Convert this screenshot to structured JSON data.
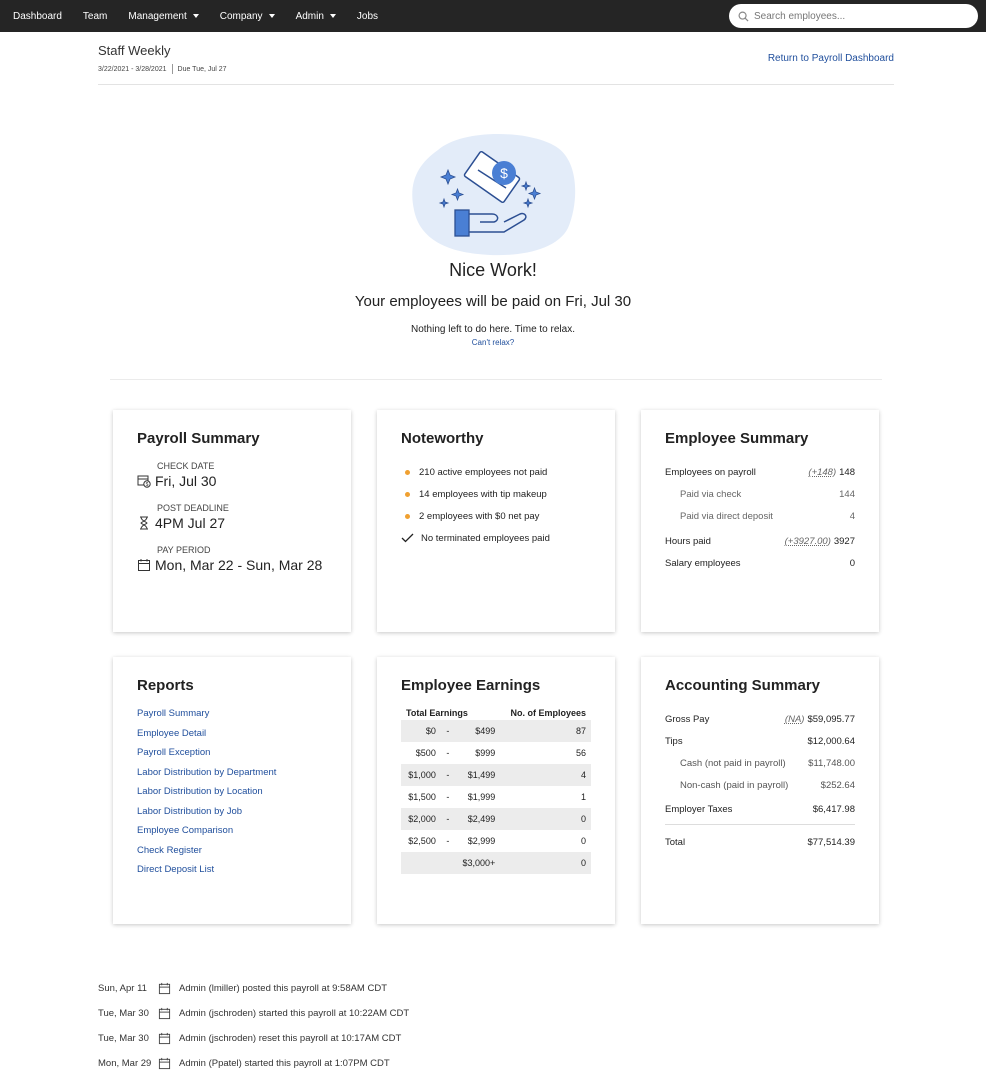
{
  "nav": {
    "items": [
      {
        "label": "Dashboard",
        "dropdown": false
      },
      {
        "label": "Team",
        "dropdown": false
      },
      {
        "label": "Management",
        "dropdown": true
      },
      {
        "label": "Company",
        "dropdown": true
      },
      {
        "label": "Admin",
        "dropdown": true
      },
      {
        "label": "Jobs",
        "dropdown": false
      }
    ],
    "search_placeholder": "Search employees..."
  },
  "header": {
    "title": "Staff Weekly",
    "date_range": "3/22/2021 - 3/28/2021",
    "due": "Due Tue, Jul 27",
    "return_link": "Return to Payroll Dashboard"
  },
  "hero": {
    "title": "Nice Work!",
    "line": "Your employees will be paid on Fri, Jul 30",
    "small": "Nothing left to do here. Time to relax.",
    "link": "Can't relax?"
  },
  "payroll_summary": {
    "title": "Payroll Summary",
    "check_date_label": "CHECK DATE",
    "check_date": "Fri, Jul 30",
    "post_deadline_label": "POST DEADLINE",
    "post_deadline": "4PM Jul 27",
    "pay_period_label": "PAY PERIOD",
    "pay_period": "Mon, Mar 22 - Sun, Mar 28"
  },
  "noteworthy": {
    "title": "Noteworthy",
    "items": [
      "210 active employees not paid",
      "14 employees with tip makeup",
      "2 employees with $0 net pay"
    ],
    "check_item": "No terminated employees paid"
  },
  "employee_summary": {
    "title": "Employee Summary",
    "on_payroll_label": "Employees on payroll",
    "on_payroll_delta": "(+148)",
    "on_payroll": "148",
    "via_check_label": "Paid via check",
    "via_check": "144",
    "via_dd_label": "Paid via direct deposit",
    "via_dd": "4",
    "hours_label": "Hours paid",
    "hours_delta": "(+3927.00)",
    "hours": "3927",
    "salary_label": "Salary employees",
    "salary": "0"
  },
  "reports": {
    "title": "Reports",
    "links": [
      "Payroll Summary",
      "Employee Detail",
      "Payroll Exception",
      "Labor Distribution by Department",
      "Labor Distribution by Location",
      "Labor Distribution by Job",
      "Employee Comparison",
      "Check Register",
      "Direct Deposit List"
    ]
  },
  "earnings": {
    "title": "Employee Earnings",
    "col1": "Total Earnings",
    "col2": "No. of Employees",
    "rows": [
      {
        "from": "$0",
        "sep": "-",
        "to": "$499",
        "count": "87"
      },
      {
        "from": "$500",
        "sep": "-",
        "to": "$999",
        "count": "56"
      },
      {
        "from": "$1,000",
        "sep": "-",
        "to": "$1,499",
        "count": "4"
      },
      {
        "from": "$1,500",
        "sep": "-",
        "to": "$1,999",
        "count": "1"
      },
      {
        "from": "$2,000",
        "sep": "-",
        "to": "$2,499",
        "count": "0"
      },
      {
        "from": "$2,500",
        "sep": "-",
        "to": "$2,999",
        "count": "0"
      },
      {
        "from": "",
        "sep": "",
        "to": "$3,000+",
        "count": "0"
      }
    ]
  },
  "accounting": {
    "title": "Accounting Summary",
    "gross_label": "Gross Pay",
    "gross_delta": "(NA)",
    "gross": "$59,095.77",
    "tips_label": "Tips",
    "tips": "$12,000.64",
    "cash_label": "Cash (not paid in payroll)",
    "cash": "$11,748.00",
    "noncash_label": "Non-cash (paid in payroll)",
    "noncash": "$252.64",
    "taxes_label": "Employer Taxes",
    "taxes": "$6,417.98",
    "total_label": "Total",
    "total": "$77,514.39"
  },
  "activity": [
    {
      "date": "Sun, Apr 11",
      "text": "Admin (lmiller) posted this payroll at 9:58AM CDT"
    },
    {
      "date": "Tue, Mar 30",
      "text": "Admin (jschroden) started this payroll at 10:22AM CDT"
    },
    {
      "date": "Tue, Mar 30",
      "text": "Admin (jschroden) reset this payroll at 10:17AM CDT"
    },
    {
      "date": "Mon, Mar 29",
      "text": "Admin (Ppatel) started this payroll at 1:07PM CDT"
    }
  ],
  "colors": {
    "nav_bg": "#252525",
    "link": "#1f4e9c",
    "accent_dot": "#f0a030",
    "illustration": "#4a7fd4"
  }
}
